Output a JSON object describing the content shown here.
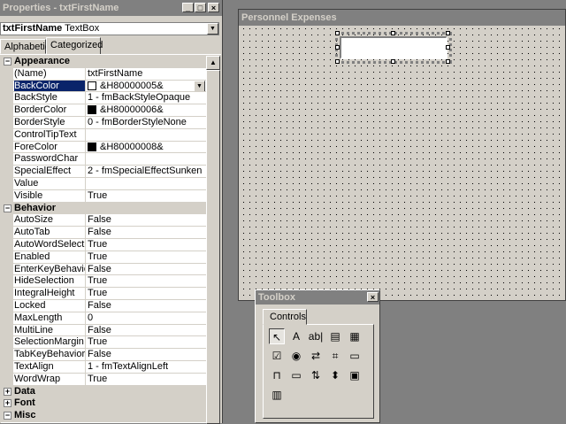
{
  "properties_window": {
    "title": "Properties - txtFirstName",
    "object_selector": {
      "name": "txtFirstName",
      "type": "TextBox"
    },
    "tabs": [
      {
        "label": "Alphabetic",
        "active": false
      },
      {
        "label": "Categorized",
        "active": true
      }
    ],
    "rows": [
      {
        "kind": "category",
        "expander": "⊟",
        "name": "Appearance"
      },
      {
        "kind": "prop",
        "name": "(Name)",
        "value": "txtFirstName"
      },
      {
        "kind": "prop",
        "name": "BackColor",
        "value": "&H80000005&",
        "swatch": "#ffffff",
        "selected": true
      },
      {
        "kind": "prop",
        "name": "BackStyle",
        "value": "1 - fmBackStyleOpaque"
      },
      {
        "kind": "prop",
        "name": "BorderColor",
        "value": "&H80000006&",
        "swatch": "#000000"
      },
      {
        "kind": "prop",
        "name": "BorderStyle",
        "value": "0 - fmBorderStyleNone"
      },
      {
        "kind": "prop",
        "name": "ControlTipText",
        "value": ""
      },
      {
        "kind": "prop",
        "name": "ForeColor",
        "value": "&H80000008&",
        "swatch": "#000000"
      },
      {
        "kind": "prop",
        "name": "PasswordChar",
        "value": ""
      },
      {
        "kind": "prop",
        "name": "SpecialEffect",
        "value": "2 - fmSpecialEffectSunken"
      },
      {
        "kind": "prop",
        "name": "Value",
        "value": ""
      },
      {
        "kind": "prop",
        "name": "Visible",
        "value": "True"
      },
      {
        "kind": "category",
        "expander": "⊟",
        "name": "Behavior"
      },
      {
        "kind": "prop",
        "name": "AutoSize",
        "value": "False"
      },
      {
        "kind": "prop",
        "name": "AutoTab",
        "value": "False"
      },
      {
        "kind": "prop",
        "name": "AutoWordSelect",
        "value": "True"
      },
      {
        "kind": "prop",
        "name": "Enabled",
        "value": "True"
      },
      {
        "kind": "prop",
        "name": "EnterKeyBehavior",
        "value": "False"
      },
      {
        "kind": "prop",
        "name": "HideSelection",
        "value": "True"
      },
      {
        "kind": "prop",
        "name": "IntegralHeight",
        "value": "True"
      },
      {
        "kind": "prop",
        "name": "Locked",
        "value": "False"
      },
      {
        "kind": "prop",
        "name": "MaxLength",
        "value": "0"
      },
      {
        "kind": "prop",
        "name": "MultiLine",
        "value": "False"
      },
      {
        "kind": "prop",
        "name": "SelectionMargin",
        "value": "True"
      },
      {
        "kind": "prop",
        "name": "TabKeyBehavior",
        "value": "False"
      },
      {
        "kind": "prop",
        "name": "TextAlign",
        "value": "1 - fmTextAlignLeft"
      },
      {
        "kind": "prop",
        "name": "WordWrap",
        "value": "True"
      },
      {
        "kind": "category",
        "expander": "⊞",
        "name": "Data"
      },
      {
        "kind": "category",
        "expander": "⊞",
        "name": "Font"
      },
      {
        "kind": "category",
        "expander": "⊟",
        "name": "Misc"
      }
    ]
  },
  "designer": {
    "title": "Personnel Expenses"
  },
  "toolbox": {
    "title": "Toolbox",
    "tab_label": "Controls",
    "tools": [
      {
        "icon": "select-objects-icon",
        "glyph": "↖"
      },
      {
        "icon": "label-icon",
        "glyph": "A"
      },
      {
        "icon": "textbox-icon",
        "glyph": "ab|"
      },
      {
        "icon": "combobox-icon",
        "glyph": "▤"
      },
      {
        "icon": "listbox-icon",
        "glyph": "▦"
      },
      {
        "icon": "checkbox-icon",
        "glyph": "☑"
      },
      {
        "icon": "optionbutton-icon",
        "glyph": "◉"
      },
      {
        "icon": "togglebutton-icon",
        "glyph": "⇄"
      },
      {
        "icon": "frame-icon",
        "glyph": "⌗"
      },
      {
        "icon": "commandbutton-icon",
        "glyph": "▭"
      },
      {
        "icon": "tabstrip-icon",
        "glyph": "⊓"
      },
      {
        "icon": "multipage-icon",
        "glyph": "▭"
      },
      {
        "icon": "scrollbar-icon",
        "glyph": "⇅"
      },
      {
        "icon": "spinbutton-icon",
        "glyph": "⬍"
      },
      {
        "icon": "image-icon",
        "glyph": "▣"
      },
      {
        "icon": "refedit-icon",
        "glyph": "▥"
      }
    ]
  }
}
